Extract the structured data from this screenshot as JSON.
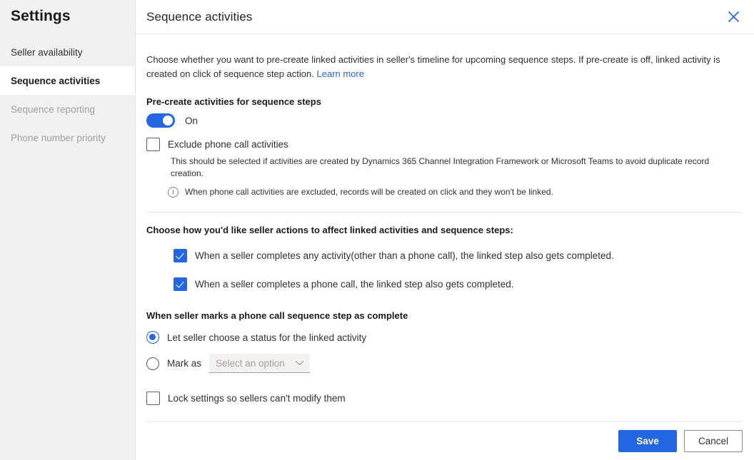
{
  "sidebar": {
    "title": "Settings",
    "items": [
      {
        "label": "Seller availability",
        "state": "normal"
      },
      {
        "label": "Sequence activities",
        "state": "selected"
      },
      {
        "label": "Sequence reporting",
        "state": "disabled"
      },
      {
        "label": "Phone number priority",
        "state": "disabled"
      }
    ]
  },
  "panel": {
    "title": "Sequence activities",
    "close_icon": "close-icon",
    "description": "Choose whether you want to pre-create linked activities in seller's timeline for upcoming sequence steps. If pre-create is off, linked activity is created on click of sequence step action.",
    "learn_more": "Learn more",
    "precreate": {
      "label": "Pre-create activities for sequence steps",
      "toggle_state": "On",
      "toggle_on": true,
      "toggle_color": "#2266e3"
    },
    "exclude": {
      "label": "Exclude phone call activities",
      "checked": false,
      "sub_note": "This should be selected if activities are created by Dynamics 365 Channel Integration Framework or Microsoft Teams to avoid duplicate record creation.",
      "info_icon": "info-circle-icon",
      "info_text": "When phone call activities are excluded, records will be created on click and they won't be linked."
    },
    "seller_actions": {
      "title": "Choose how you'd like seller actions to affect linked activities and sequence steps:",
      "options": [
        {
          "label": "When a seller completes any activity(other than a phone call), the linked step also gets completed.",
          "checked": true
        },
        {
          "label": "When a seller completes a phone call, the linked step also gets completed.",
          "checked": true
        }
      ]
    },
    "phone_call_complete": {
      "title": "When seller marks a phone call sequence step as complete",
      "option_1": {
        "label": "Let seller choose a status for the linked activity",
        "selected": true
      },
      "option_2": {
        "label": "Mark as",
        "selected": false
      },
      "dropdown": {
        "placeholder": "Select an option",
        "value": "Select an option",
        "chevron_icon": "chevron-down-icon"
      }
    },
    "lock": {
      "label": "Lock settings so sellers can't modify them",
      "checked": false
    }
  },
  "footer": {
    "save_label": "Save",
    "cancel_label": "Cancel"
  },
  "colors": {
    "accent": "#2266e3",
    "sidebar_bg": "#f1f1f1",
    "text": "#323130",
    "disabled_text": "#a19f9d"
  }
}
